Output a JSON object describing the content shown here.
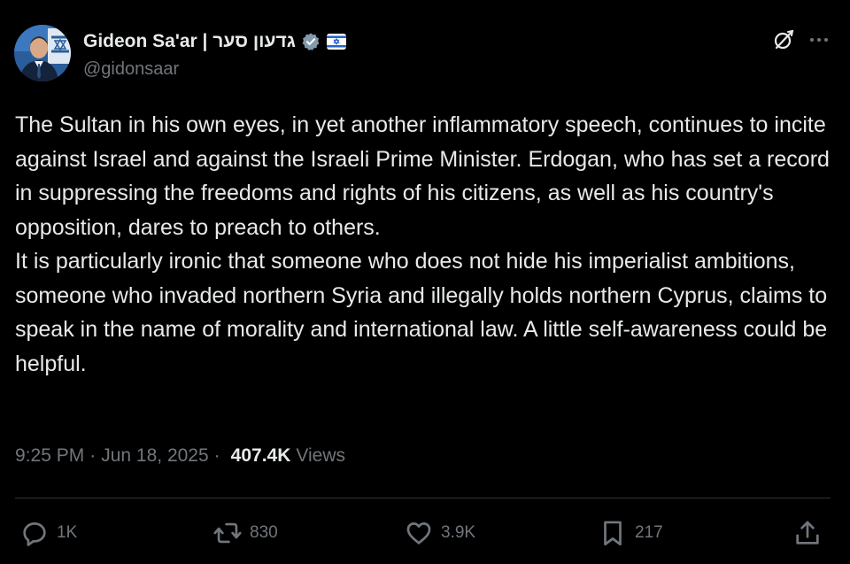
{
  "author": {
    "name": "Gideon Sa'ar | גדעון סער",
    "handle": "@gidonsaar"
  },
  "tweet": {
    "paragraphs": [
      "The Sultan in his own eyes, in yet another inflammatory speech, continues to incite against Israel and against the Israeli Prime Minister. Erdogan, who has set a record in suppressing the freedoms and rights of his citizens, as well as his country's opposition, dares to preach to others.",
      "It is particularly ironic that someone who does not hide his imperialist ambitions, someone who invaded northern Syria and illegally holds northern Cyprus, claims to speak in the name of morality and international law. A little self-awareness could be helpful."
    ],
    "time": "9:25 PM",
    "date": "Jun 18, 2025",
    "views_count": "407.4K",
    "views_label": "Views"
  },
  "actions": {
    "replies": "1K",
    "reposts": "830",
    "likes": "3.9K",
    "bookmarks": "217"
  },
  "icons": {
    "reply": "reply-icon",
    "repost": "repost-icon",
    "like": "like-icon",
    "bookmark": "bookmark-icon",
    "share": "share-icon",
    "verified": "verified-badge-icon",
    "affiliate": "israel-flag-badge-icon",
    "grok": "grok-icon",
    "more": "more-icon"
  },
  "colors": {
    "background": "#000000",
    "text": "#e7e9ea",
    "secondary": "#71767b",
    "divider": "#2f3336",
    "verified": "#829aab"
  }
}
